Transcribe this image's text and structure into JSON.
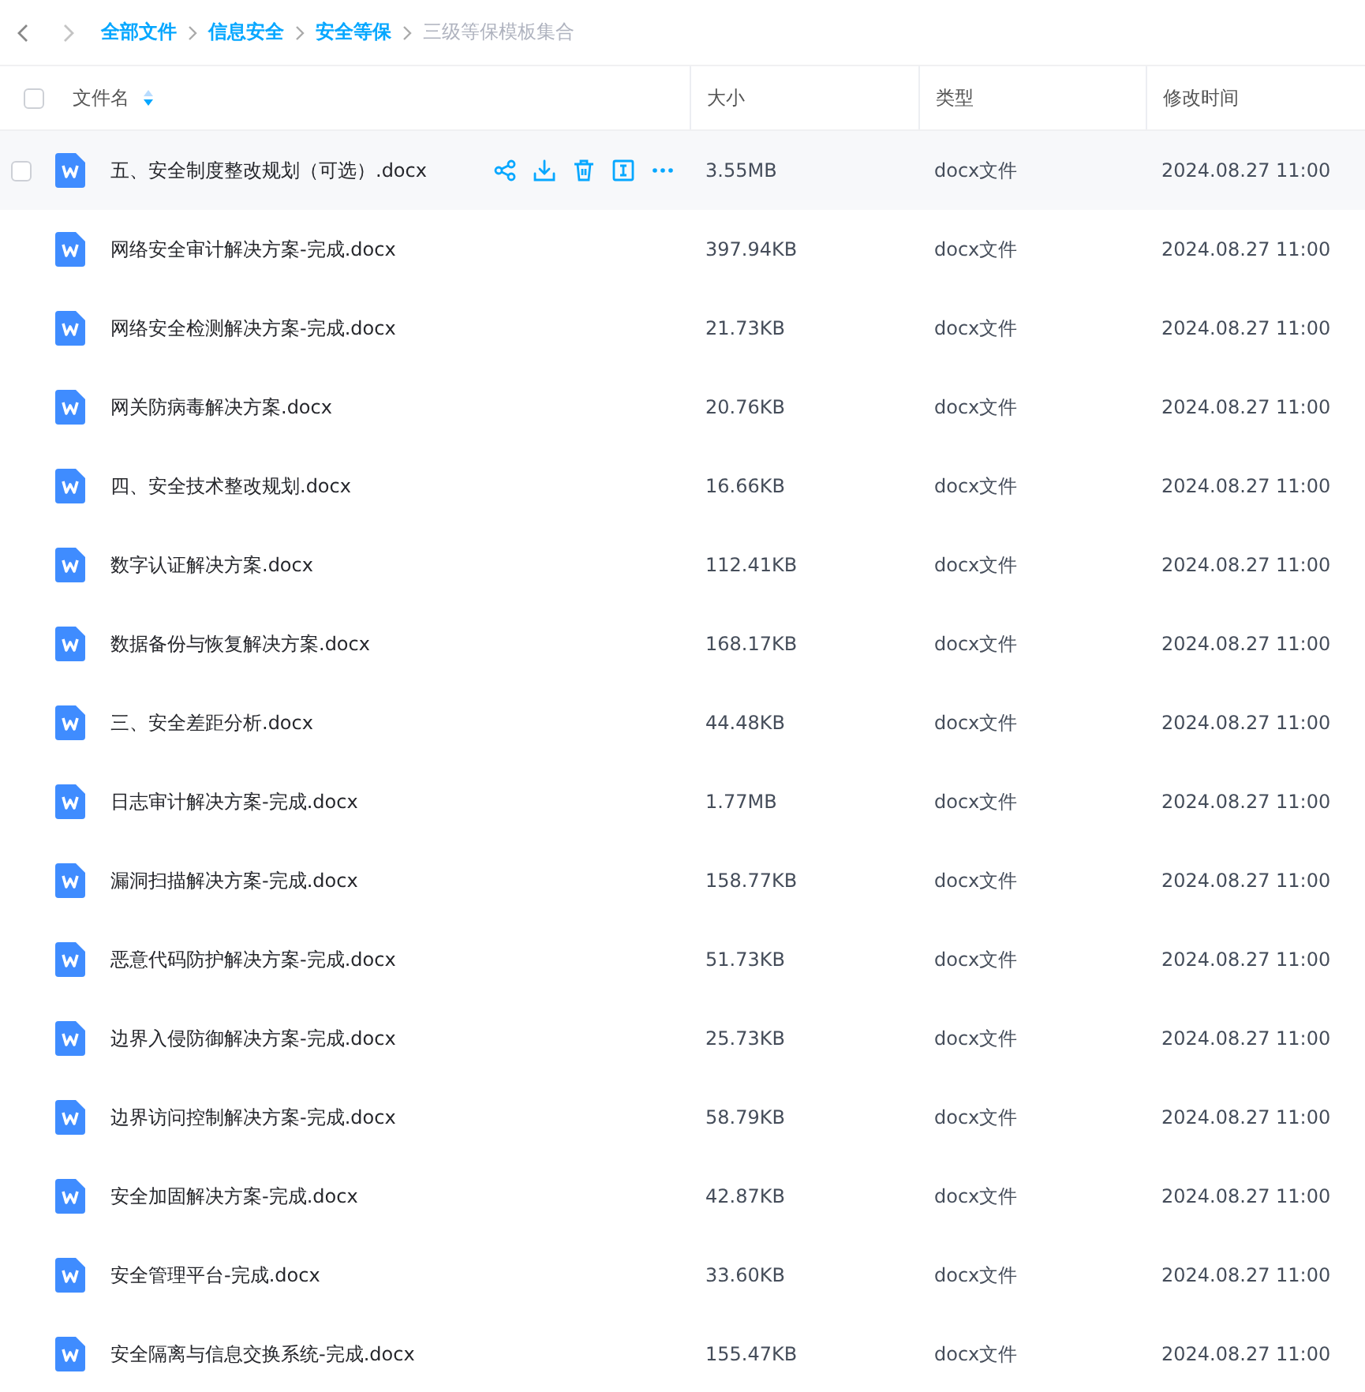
{
  "breadcrumb": [
    {
      "label": "全部文件",
      "current": false
    },
    {
      "label": "信息安全",
      "current": false
    },
    {
      "label": "安全等保",
      "current": false
    },
    {
      "label": "三级等保模板集合",
      "current": true
    }
  ],
  "table": {
    "columns": [
      "文件名",
      "大小",
      "类型",
      "修改时间"
    ],
    "select_all": {
      "checked": false
    },
    "rows": [
      {
        "name": "五、安全制度整改规划（可选）.docx",
        "size": "3.55MB",
        "type": "docx文件",
        "modified": "2024.08.27 11:00",
        "hovered": true,
        "checked": false
      },
      {
        "name": "网络安全审计解决方案-完成.docx",
        "size": "397.94KB",
        "type": "docx文件",
        "modified": "2024.08.27 11:00",
        "hovered": false,
        "checked": false
      },
      {
        "name": "网络安全检测解决方案-完成.docx",
        "size": "21.73KB",
        "type": "docx文件",
        "modified": "2024.08.27 11:00",
        "hovered": false,
        "checked": false
      },
      {
        "name": "网关防病毒解决方案.docx",
        "size": "20.76KB",
        "type": "docx文件",
        "modified": "2024.08.27 11:00",
        "hovered": false,
        "checked": false
      },
      {
        "name": "四、安全技术整改规划.docx",
        "size": "16.66KB",
        "type": "docx文件",
        "modified": "2024.08.27 11:00",
        "hovered": false,
        "checked": false
      },
      {
        "name": "数字认证解决方案.docx",
        "size": "112.41KB",
        "type": "docx文件",
        "modified": "2024.08.27 11:00",
        "hovered": false,
        "checked": false
      },
      {
        "name": "数据备份与恢复解决方案.docx",
        "size": "168.17KB",
        "type": "docx文件",
        "modified": "2024.08.27 11:00",
        "hovered": false,
        "checked": false
      },
      {
        "name": "三、安全差距分析.docx",
        "size": "44.48KB",
        "type": "docx文件",
        "modified": "2024.08.27 11:00",
        "hovered": false,
        "checked": false
      },
      {
        "name": "日志审计解决方案-完成.docx",
        "size": "1.77MB",
        "type": "docx文件",
        "modified": "2024.08.27 11:00",
        "hovered": false,
        "checked": false
      },
      {
        "name": "漏洞扫描解决方案-完成.docx",
        "size": "158.77KB",
        "type": "docx文件",
        "modified": "2024.08.27 11:00",
        "hovered": false,
        "checked": false
      },
      {
        "name": "恶意代码防护解决方案-完成.docx",
        "size": "51.73KB",
        "type": "docx文件",
        "modified": "2024.08.27 11:00",
        "hovered": false,
        "checked": false
      },
      {
        "name": "边界入侵防御解决方案-完成.docx",
        "size": "25.73KB",
        "type": "docx文件",
        "modified": "2024.08.27 11:00",
        "hovered": false,
        "checked": false
      },
      {
        "name": "边界访问控制解决方案-完成.docx",
        "size": "58.79KB",
        "type": "docx文件",
        "modified": "2024.08.27 11:00",
        "hovered": false,
        "checked": false
      },
      {
        "name": "安全加固解决方案-完成.docx",
        "size": "42.87KB",
        "type": "docx文件",
        "modified": "2024.08.27 11:00",
        "hovered": false,
        "checked": false
      },
      {
        "name": "安全管理平台-完成.docx",
        "size": "33.60KB",
        "type": "docx文件",
        "modified": "2024.08.27 11:00",
        "hovered": false,
        "checked": false
      },
      {
        "name": "安全隔离与信息交换系统-完成.docx",
        "size": "155.47KB",
        "type": "docx文件",
        "modified": "2024.08.27 11:00",
        "hovered": false,
        "checked": false
      }
    ]
  }
}
